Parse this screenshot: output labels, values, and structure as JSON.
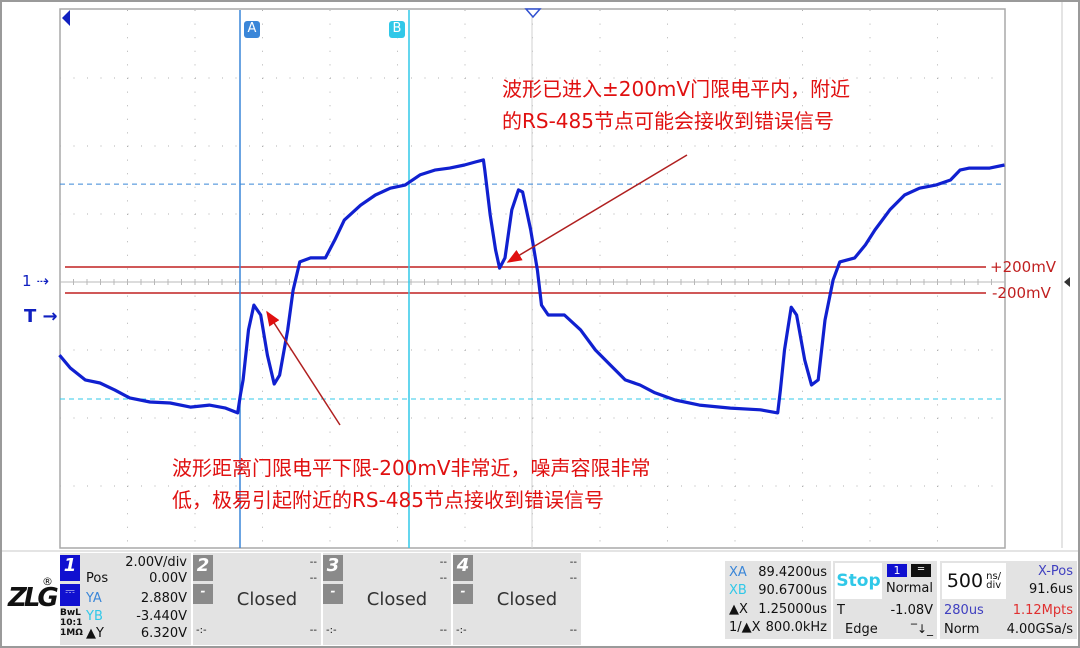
{
  "chart_data": {
    "type": "line",
    "title": "",
    "xlabel": "",
    "ylabel": "",
    "x_unit": "us",
    "y_unit": "V",
    "xlim": [
      88.1,
      95.1
    ],
    "ylim": [
      -8,
      8
    ],
    "grid": true,
    "series": [
      {
        "color": "#1020d0",
        "x": [
          88.1,
          88.18,
          88.29,
          88.4,
          88.51,
          88.62,
          88.77,
          88.92,
          89.07,
          89.21,
          89.33,
          89.42,
          89.44,
          89.46,
          89.5,
          89.54,
          89.59,
          89.64,
          89.69,
          89.73,
          89.79,
          89.83,
          89.88,
          89.96,
          90.07,
          90.14,
          90.21,
          90.33,
          90.44,
          90.55,
          90.66,
          90.77,
          90.88,
          90.99,
          91.1,
          91.18,
          91.24,
          91.25,
          91.29,
          91.33,
          91.36,
          91.4,
          91.45,
          91.5,
          91.53,
          91.59,
          91.64,
          91.67,
          91.72,
          91.84,
          91.96,
          92.07,
          92.18,
          92.29,
          92.4,
          92.51,
          92.66,
          92.84,
          93.07,
          93.29,
          93.42,
          93.44,
          93.47,
          93.52,
          93.56,
          93.62,
          93.67,
          93.72,
          93.77,
          93.83,
          93.88,
          93.99,
          94.07,
          94.14,
          94.25,
          94.36,
          94.47,
          94.59,
          94.7,
          94.77,
          94.84,
          94.99,
          95.1
        ],
        "y": [
          -2.15,
          -2.53,
          -2.88,
          -2.97,
          -3.18,
          -3.41,
          -3.53,
          -3.56,
          -3.68,
          -3.62,
          -3.71,
          -3.85,
          -3.32,
          -2.88,
          -1.41,
          -0.68,
          -0.97,
          -2.15,
          -3.0,
          -2.74,
          -1.41,
          -0.24,
          0.59,
          0.71,
          0.71,
          1.24,
          1.82,
          2.26,
          2.56,
          2.76,
          2.85,
          3.15,
          3.29,
          3.35,
          3.44,
          3.53,
          3.59,
          3.29,
          1.97,
          0.94,
          0.41,
          0.71,
          2.12,
          2.71,
          2.65,
          1.53,
          0.35,
          -0.68,
          -0.97,
          -0.97,
          -1.41,
          -2.0,
          -2.44,
          -2.88,
          -3.03,
          -3.26,
          -3.47,
          -3.62,
          -3.71,
          -3.76,
          -3.85,
          -3.18,
          -2.0,
          -0.74,
          -0.97,
          -2.29,
          -3.03,
          -2.88,
          -1.12,
          0.06,
          0.59,
          0.71,
          1.09,
          1.53,
          2.12,
          2.56,
          2.76,
          2.85,
          3.0,
          3.29,
          3.35,
          3.35,
          3.44
        ]
      }
    ],
    "reference_lines": [
      {
        "label": "+200mV",
        "color": "#c02020"
      },
      {
        "label": "-200mV",
        "color": "#c02020"
      }
    ],
    "annotations": [
      {
        "lines": [
          "波形已进入±200mV门限电平内，附近",
          "的RS-485节点可能会接收到错误信号"
        ],
        "color": "#e01010"
      },
      {
        "lines": [
          "波形距离门限电平下限-200mV非常近，噪声容限非常",
          "低，极易引起附近的RS-485节点接收到错误信号"
        ],
        "color": "#e01010"
      }
    ]
  },
  "cursors": {
    "a_label": "A",
    "b_label": "B",
    "a_color": "#3a86d8",
    "b_color": "#30c8e8"
  },
  "markers": {
    "ch1": "1",
    "trigger": "T"
  },
  "logo": "ZLG",
  "channels": [
    {
      "num": "1",
      "scale": "2.00V/div",
      "pos_label": "Pos",
      "pos": "0.00V",
      "ya_label": "YA",
      "ya": "2.880V",
      "yb_label": "YB",
      "yb": "-3.440V",
      "dy_label": "▲Y",
      "dy": "6.320V",
      "bw": "BwL",
      "probe": "10:1",
      "imp": "1MΩ"
    },
    {
      "num": "2",
      "status": "Closed",
      "dash": "--",
      "minus": "-",
      "coupling": "-:-"
    },
    {
      "num": "3",
      "status": "Closed",
      "dash": "--",
      "minus": "-",
      "coupling": "-:-"
    },
    {
      "num": "4",
      "status": "Closed",
      "dash": "--",
      "minus": "-",
      "coupling": "-:-"
    }
  ],
  "measure": {
    "xa_label": "XA",
    "xa": "89.4200us",
    "xb_label": "XB",
    "xb": "90.6700us",
    "dx_label": "▲X",
    "dx": "1.25000us",
    "inv_label": "1/▲X",
    "inv": "800.0kHz"
  },
  "trigger": {
    "state": "Stop",
    "source": "1",
    "mode": "Normal",
    "t_label": "T",
    "level": "-1.08V",
    "type": "Edge"
  },
  "timebase": {
    "value": "500",
    "unit_top": "ns/",
    "unit_bottom": "div",
    "xpos_label": "X-Pos",
    "xpos": "91.6us",
    "length": "280us",
    "points": "1.12Mpts",
    "acq": "Norm",
    "rate": "4.00GSa/s"
  }
}
